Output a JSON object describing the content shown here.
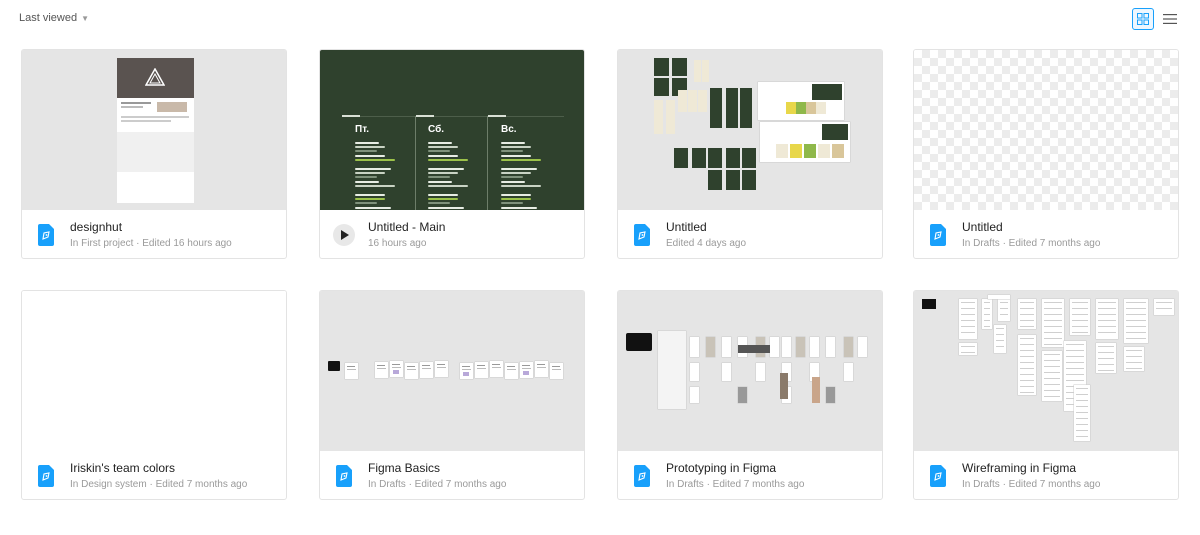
{
  "toolbar": {
    "sort_label": "Last viewed",
    "sort_chevron": "chevron-down-icon",
    "grid_view_icon": "grid-view-icon",
    "list_view_icon": "list-view-icon"
  },
  "colors": {
    "accent": "#18a0fb",
    "file_icon": "#18a0fb",
    "dark_thumb": "#2f412d",
    "thumb_grey": "#e5e5e5"
  },
  "files": [
    {
      "title": "designhut",
      "subtitle": "In First project · Edited 16 hours ago",
      "icon": "figma-file-icon"
    },
    {
      "title": "Untitled - Main",
      "subtitle": "16 hours ago",
      "icon": "play-icon"
    },
    {
      "title": "Untitled",
      "subtitle": "Edited 4 days ago",
      "icon": "figma-file-icon"
    },
    {
      "title": "Untitled",
      "subtitle": "In Drafts · Edited 7 months ago",
      "icon": "figma-file-icon"
    },
    {
      "title": "Iriskin's team colors",
      "subtitle": "In Design system · Edited 7 months ago",
      "icon": "figma-file-icon"
    },
    {
      "title": "Figma Basics",
      "subtitle": "In Drafts · Edited 7 months ago",
      "icon": "figma-file-icon"
    },
    {
      "title": "Prototyping in Figma",
      "subtitle": "In Drafts · Edited 7 months ago",
      "icon": "figma-file-icon"
    },
    {
      "title": "Wireframing in Figma",
      "subtitle": "In Drafts · Edited 7 months ago",
      "icon": "figma-file-icon"
    }
  ],
  "schedule_thumb": {
    "days": [
      "Пт.",
      "Сб.",
      "Вс."
    ]
  }
}
